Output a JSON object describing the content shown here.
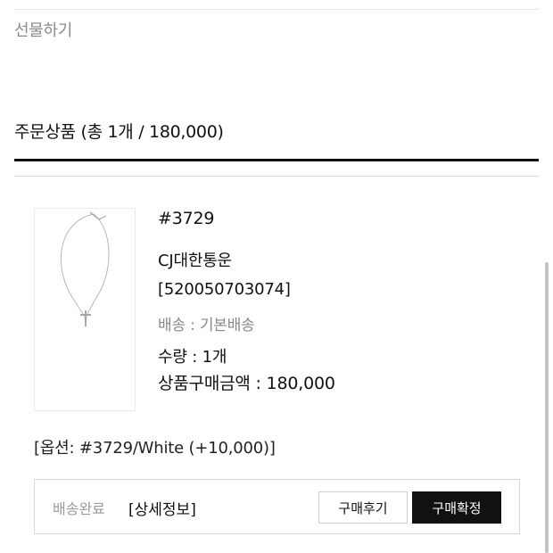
{
  "gift": {
    "label": "선물하기"
  },
  "order": {
    "heading": "주문상품 (총 1개 / 180,000)"
  },
  "item": {
    "name": "#3729",
    "carrier": "CJ대한통운",
    "tracking": "[520050703074]",
    "shipping": "배송 : 기본배송",
    "quantity": "수량 : 1개",
    "price": "상품구매금액 : 180,000",
    "option": "[옵션: #3729/White (+10,000)]",
    "image_icon": "necklace-image"
  },
  "actions": {
    "status": "배송완료",
    "detail_link": "[상세정보]",
    "review_button": "구매후기",
    "confirm_button": "구매확정"
  },
  "colors": {
    "primary_button": "#111111",
    "muted_text": "#8a8a8a",
    "divider": "#dcdcdc"
  }
}
